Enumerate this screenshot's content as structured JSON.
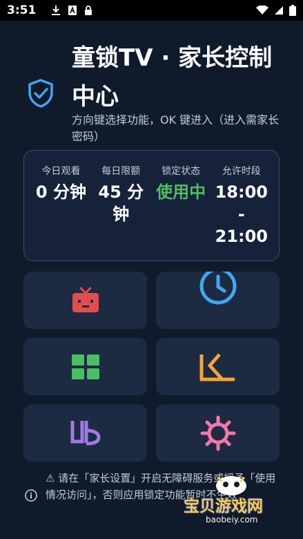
{
  "status_bar": {
    "time": "3:51",
    "icons": [
      "download-icon",
      "text-a-icon",
      "lock-icon",
      "wifi-icon",
      "signal-icon",
      "battery-icon"
    ]
  },
  "header": {
    "title": "童锁TV · 家长控制中心",
    "subtitle": "方向键选择功能，OK 键进入（进入需家长密码）",
    "icon": "shield-check-icon"
  },
  "stats": [
    {
      "label": "今日观看",
      "value": "0 分钟"
    },
    {
      "label": "每日限额",
      "value": "45 分钟"
    },
    {
      "label": "锁定状态",
      "value": "使用中",
      "color": "#4cbe62"
    },
    {
      "label": "允许时段",
      "value": "18:00 - 21:00"
    }
  ],
  "tiles": [
    {
      "icon": "tv-icon",
      "color": "#e74c4c"
    },
    {
      "icon": "clock-icon",
      "color": "#3fa7f0"
    },
    {
      "icon": "apps-grid-icon",
      "color": "#4cbe62"
    },
    {
      "icon": "k-logo-icon",
      "color": "#f3a53a"
    },
    {
      "icon": "ub-logo-icon",
      "color": "#a07ae6"
    },
    {
      "icon": "gear-icon",
      "color": "#f277a8"
    }
  ],
  "footer": {
    "notice": "⚠ 请在「家长设置」开启无障碍服务或授予「使用情况访问」，否则应用锁定功能暂时不生效"
  },
  "watermark": {
    "text": "宝贝游戏网",
    "url": "baobeiy.com"
  },
  "colors": {
    "background": "#0f1a2b",
    "card": "#1c2a42",
    "accent_blue": "#3fa7f0"
  }
}
